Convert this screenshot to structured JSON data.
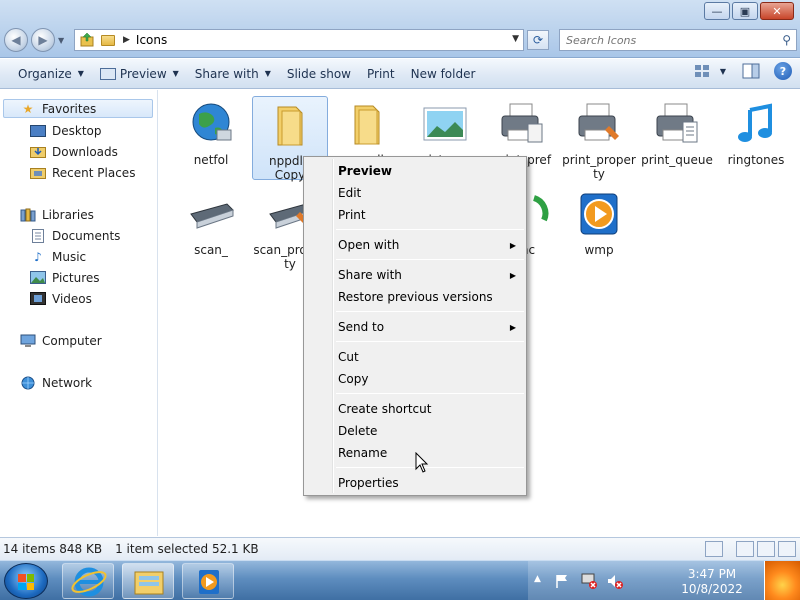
{
  "window": {
    "minimize_label": "—",
    "maximize_label": "▣",
    "close_label": "✕"
  },
  "address": {
    "path_label": "Icons"
  },
  "search": {
    "placeholder": "Search Icons"
  },
  "toolbar": {
    "organize_label": "Organize",
    "preview_label": "Preview",
    "share_label": "Share with",
    "slideshow_label": "Slide show",
    "print_label": "Print",
    "newfolder_label": "New folder",
    "help_label": "?"
  },
  "nav": {
    "favorites": "Favorites",
    "desktop": "Desktop",
    "downloads": "Downloads",
    "recent": "Recent Places",
    "libraries": "Libraries",
    "documents": "Documents",
    "music": "Music",
    "pictures": "Pictures",
    "videos": "Videos",
    "computer": "Computer",
    "network": "Network"
  },
  "files": {
    "netfol": "netfol",
    "nppdl_copy": "nppdl - Copy",
    "nppdl": "nppdl",
    "pictures": "pictures",
    "print_pref": "print_pref",
    "print_property": "print_property",
    "print_queue": "print_queue",
    "ringtones": "ringtones",
    "scan_": "scan_",
    "scan_property": "scan_property",
    "sync_partial": "nc",
    "wmp": "wmp"
  },
  "menu": {
    "preview": "Preview",
    "edit": "Edit",
    "print": "Print",
    "open_with": "Open with",
    "share_with": "Share with",
    "restore": "Restore previous versions",
    "send_to": "Send to",
    "cut": "Cut",
    "copy": "Copy",
    "create_shortcut": "Create shortcut",
    "delete": "Delete",
    "rename": "Rename",
    "properties": "Properties"
  },
  "status": {
    "items": "14 items",
    "size": "848 KB",
    "selected": "1 item selected",
    "selected_size": "52.1 KB"
  },
  "taskbar": {
    "time": "3:47 PM",
    "date": "10/8/2022"
  },
  "colors": {
    "accent": "#1d6ac0",
    "selection": "#cfe3f9",
    "folder": "#f2cf6a"
  }
}
